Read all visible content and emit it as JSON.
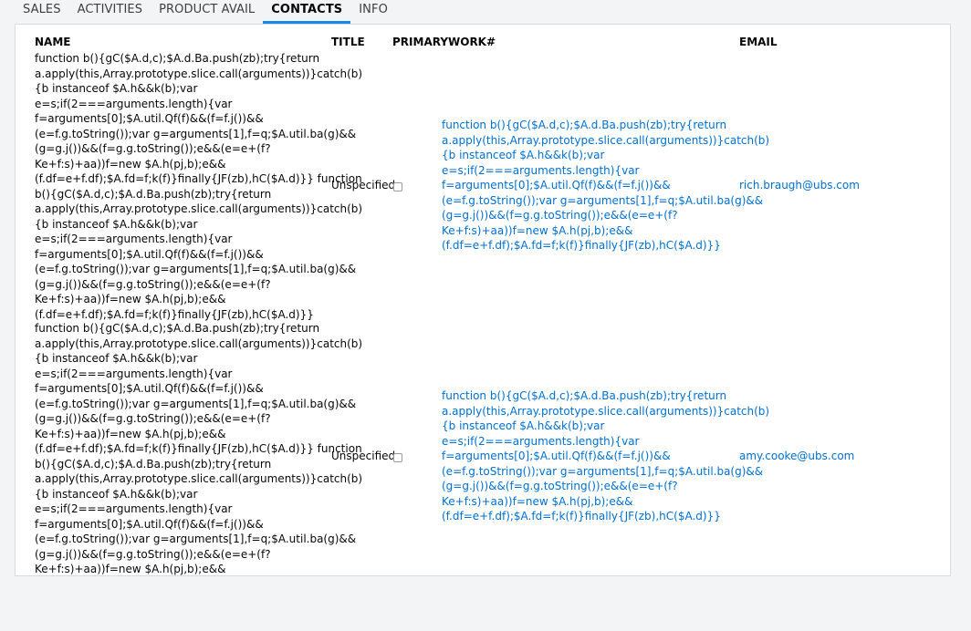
{
  "tabs": [
    {
      "label": "SALES"
    },
    {
      "label": "ACTIVITIES"
    },
    {
      "label": "PRODUCT AVAIL"
    },
    {
      "label": "CONTACTS"
    },
    {
      "label": "INFO"
    }
  ],
  "table": {
    "headers": {
      "name": "NAME",
      "title": "TITLE",
      "primary_work": "PRIMARYWORK#",
      "email": "EMAIL"
    },
    "rows": [
      {
        "name": "function b(){gC($A.d,c);$A.d.Ba.push(zb);try{return\na.apply(this,Array.prototype.slice.call(arguments))}catch(b)\n{b instanceof $A.h&&k(b);var\ne=s;if(2===arguments.length){var\nf=arguments[0];$A.util.Qf(f)&&(f=f.j())&&\n(e=f.g.toString());var g=arguments[1],f=q;$A.util.ba(g)&&\n(g=g.j())&&(f=g.g.toString());e&&(e=e+(f?\nKe+f:s)+aa))f=new $A.h(pj,b);e&&\n(f.df=e+f.df);$A.fd=f;k(f)}finally{JF(zb),hC($A.d)}} function\nb(){gC($A.d,c);$A.d.Ba.push(zb);try{return\na.apply(this,Array.prototype.slice.call(arguments))}catch(b)\n{b instanceof $A.h&&k(b);var\ne=s;if(2===arguments.length){var\nf=arguments[0];$A.util.Qf(f)&&(f=f.j())&&\n(e=f.g.toString());var g=arguments[1],f=q;$A.util.ba(g)&&\n(g=g.j())&&(f=g.g.toString());e&&(e=e+(f?\nKe+f:s)+aa))f=new $A.h(pj,b);e&&\n(f.df=e+f.df);$A.fd=f;k(f)}finally{JF(zb),hC($A.d)}}",
        "title": "Unspecified",
        "primary_work": "function b(){gC($A.d,c);$A.d.Ba.push(zb);try{return\na.apply(this,Array.prototype.slice.call(arguments))}catch(b)\n{b instanceof $A.h&&k(b);var\ne=s;if(2===arguments.length){var\nf=arguments[0];$A.util.Qf(f)&&(f=f.j())&&\n(e=f.g.toString());var g=arguments[1],f=q;$A.util.ba(g)&&\n(g=g.j())&&(f=g.g.toString());e&&(e=e+(f?\nKe+f:s)+aa))f=new $A.h(pj,b);e&&\n(f.df=e+f.df);$A.fd=f;k(f)}finally{JF(zb),hC($A.d)}}",
        "email": "rich.braugh@ubs.com"
      },
      {
        "name": "function b(){gC($A.d,c);$A.d.Ba.push(zb);try{return\na.apply(this,Array.prototype.slice.call(arguments))}catch(b)\n{b instanceof $A.h&&k(b);var\ne=s;if(2===arguments.length){var\nf=arguments[0];$A.util.Qf(f)&&(f=f.j())&&\n(e=f.g.toString());var g=arguments[1],f=q;$A.util.ba(g)&&\n(g=g.j())&&(f=g.g.toString());e&&(e=e+(f?\nKe+f:s)+aa))f=new $A.h(pj,b);e&&\n(f.df=e+f.df);$A.fd=f;k(f)}finally{JF(zb),hC($A.d)}} function\nb(){gC($A.d,c);$A.d.Ba.push(zb);try{return\na.apply(this,Array.prototype.slice.call(arguments))}catch(b)\n{b instanceof $A.h&&k(b);var\ne=s;if(2===arguments.length){var\nf=arguments[0];$A.util.Qf(f)&&(f=f.j())&&\n(e=f.g.toString());var g=arguments[1],f=q;$A.util.ba(g)&&\n(g=g.j())&&(f=g.g.toString());e&&(e=e+(f?\nKe+f:s)+aa))f=new $A.h(pj,b);e&&",
        "title": "Unspecified",
        "primary_work": "function b(){gC($A.d,c);$A.d.Ba.push(zb);try{return\na.apply(this,Array.prototype.slice.call(arguments))}catch(b)\n{b instanceof $A.h&&k(b);var\ne=s;if(2===arguments.length){var\nf=arguments[0];$A.util.Qf(f)&&(f=f.j())&&\n(e=f.g.toString());var g=arguments[1],f=q;$A.util.ba(g)&&\n(g=g.j())&&(f=g.g.toString());e&&(e=e+(f?\nKe+f:s)+aa))f=new $A.h(pj,b);e&&\n(f.df=e+f.df);$A.fd=f;k(f)}finally{JF(zb),hC($A.d)}}",
        "email": "amy.cooke@ubs.com"
      }
    ]
  }
}
